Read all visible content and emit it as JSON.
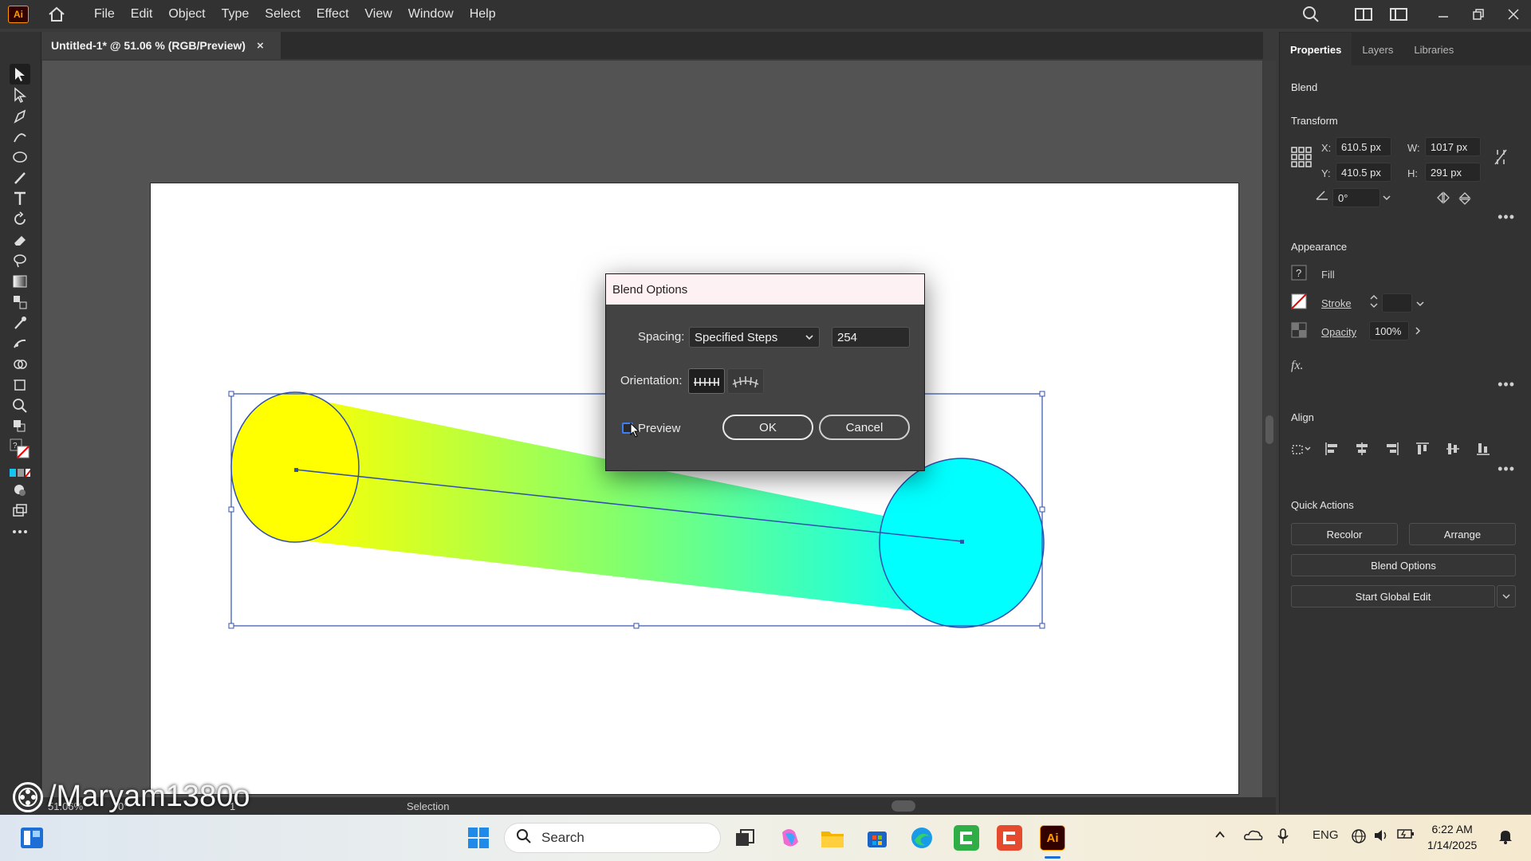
{
  "app": {
    "logo": "Ai",
    "menus": [
      "File",
      "Edit",
      "Object",
      "Type",
      "Select",
      "Effect",
      "View",
      "Window",
      "Help"
    ]
  },
  "document": {
    "tab_title": "Untitled-1* @ 51.06 % (RGB/Preview)",
    "close_glyph": "×"
  },
  "status": {
    "zoom": "51.06%",
    "angle": "0°",
    "page": "1",
    "tool": "Selection"
  },
  "watermark": "/Maryam1380o",
  "panel": {
    "tabs": [
      "Properties",
      "Layers",
      "Libraries"
    ],
    "object_type": "Blend",
    "transform": {
      "title": "Transform",
      "x_label": "X:",
      "x": "610.5 px",
      "y_label": "Y:",
      "y": "410.5 px",
      "w_label": "W:",
      "w": "1017 px",
      "h_label": "H:",
      "h": "291 px",
      "angle": "0°"
    },
    "appearance": {
      "title": "Appearance",
      "fill_label": "Fill",
      "stroke_label": "Stroke",
      "opacity_label": "Opacity",
      "opacity": "100%",
      "fx": "fx."
    },
    "align": {
      "title": "Align"
    },
    "quick_actions": {
      "title": "Quick Actions",
      "recolor": "Recolor",
      "arrange": "Arrange",
      "blend_options": "Blend Options",
      "global_edit": "Start Global Edit"
    }
  },
  "dialog": {
    "title": "Blend Options",
    "spacing_label": "Spacing:",
    "spacing_value": "Specified Steps",
    "steps_value": "254",
    "orientation_label": "Orientation:",
    "preview_label": "Preview",
    "preview_checked": false,
    "ok": "OK",
    "cancel": "Cancel"
  },
  "taskbar": {
    "search_placeholder": "Search",
    "lang": "ENG",
    "time": "6:22 AM",
    "date": "1/14/2025"
  },
  "colors": {
    "accent": "#3d7ef7",
    "blend_start": "#ffff00",
    "blend_end": "#00ffff",
    "ai_orange": "#ff9a00"
  }
}
